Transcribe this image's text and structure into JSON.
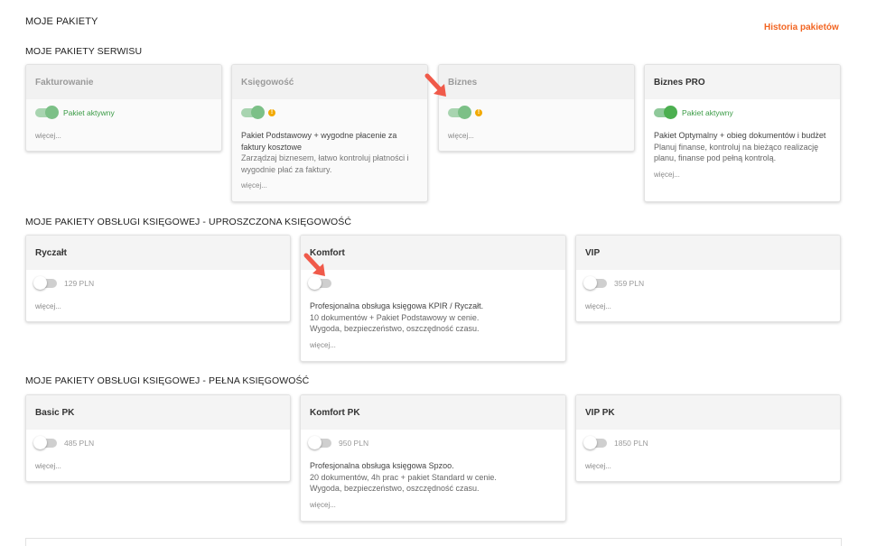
{
  "header": {
    "title": "MOJE PAKIETY",
    "history_link": "Historia pakietów"
  },
  "sections": {
    "service": {
      "title": "MOJE PAKIETY SERWISU"
    },
    "simple": {
      "title": "MOJE PAKIETY OBSŁUGI KSIĘGOWEJ - UPROSZCZONA KSIĘGOWOŚĆ"
    },
    "full": {
      "title": "MOJE PAKIETY OBSŁUGI KSIĘGOWEJ - PEŁNA KSIĘGOWOŚĆ"
    }
  },
  "service_cards": [
    {
      "name": "Fakturowanie",
      "active": true,
      "status": "Pakiet aktywny",
      "more": "więcej..."
    },
    {
      "name": "Księgowość",
      "active": true,
      "warning": "!",
      "desc_title": "Pakiet Podstawowy + wygodne płacenie za faktury kosztowe",
      "desc": "Zarządzaj biznesem, łatwo kontroluj płatności i wygodnie płać za faktury.",
      "more": "więcej..."
    },
    {
      "name": "Biznes",
      "active": true,
      "warning": "!",
      "more": "więcej..."
    },
    {
      "name": "Biznes PRO",
      "active": true,
      "status": "Pakiet aktywny",
      "desc_title": "Pakiet Optymalny + obieg dokumentów i budżet",
      "desc": "Planuj finanse, kontroluj na bieżąco realizację planu, finanse pod pełną kontrolą.",
      "more": "więcej..."
    }
  ],
  "simple_cards": [
    {
      "name": "Ryczałt",
      "active": false,
      "price": "129 PLN",
      "more": "więcej..."
    },
    {
      "name": "Komfort",
      "active": false,
      "desc_title": "Profesjonalna obsługa księgowa KPIR / Ryczałt.",
      "desc_line1": "10 dokumentów + Pakiet Podstawowy w cenie.",
      "desc_line2": "Wygoda, bezpieczeństwo, oszczędność czasu.",
      "more": "więcej..."
    },
    {
      "name": "VIP",
      "active": false,
      "price": "359 PLN",
      "more": "więcej..."
    }
  ],
  "full_cards": [
    {
      "name": "Basic PK",
      "active": false,
      "price": "485 PLN",
      "more": "więcej..."
    },
    {
      "name": "Komfort PK",
      "active": false,
      "price": "950 PLN",
      "desc_title": "Profesjonalna obsługa księgowa Spzoo.",
      "desc_line1": "20 dokumentów, 4h prac + pakiet Standard w cenie.",
      "desc_line2": "Wygoda, bezpieczeństwo, oszczędność czasu.",
      "more": "więcej..."
    },
    {
      "name": "VIP PK",
      "active": false,
      "price": "1850 PLN",
      "more": "więcej..."
    }
  ],
  "colors": {
    "accent_orange": "#f26522",
    "active_green": "#4caf50",
    "warning": "#f2a900",
    "annotation_arrow": "#f05a4a"
  },
  "icons": [
    "toggle-switch",
    "warning-icon",
    "annotation-arrow-icon"
  ]
}
